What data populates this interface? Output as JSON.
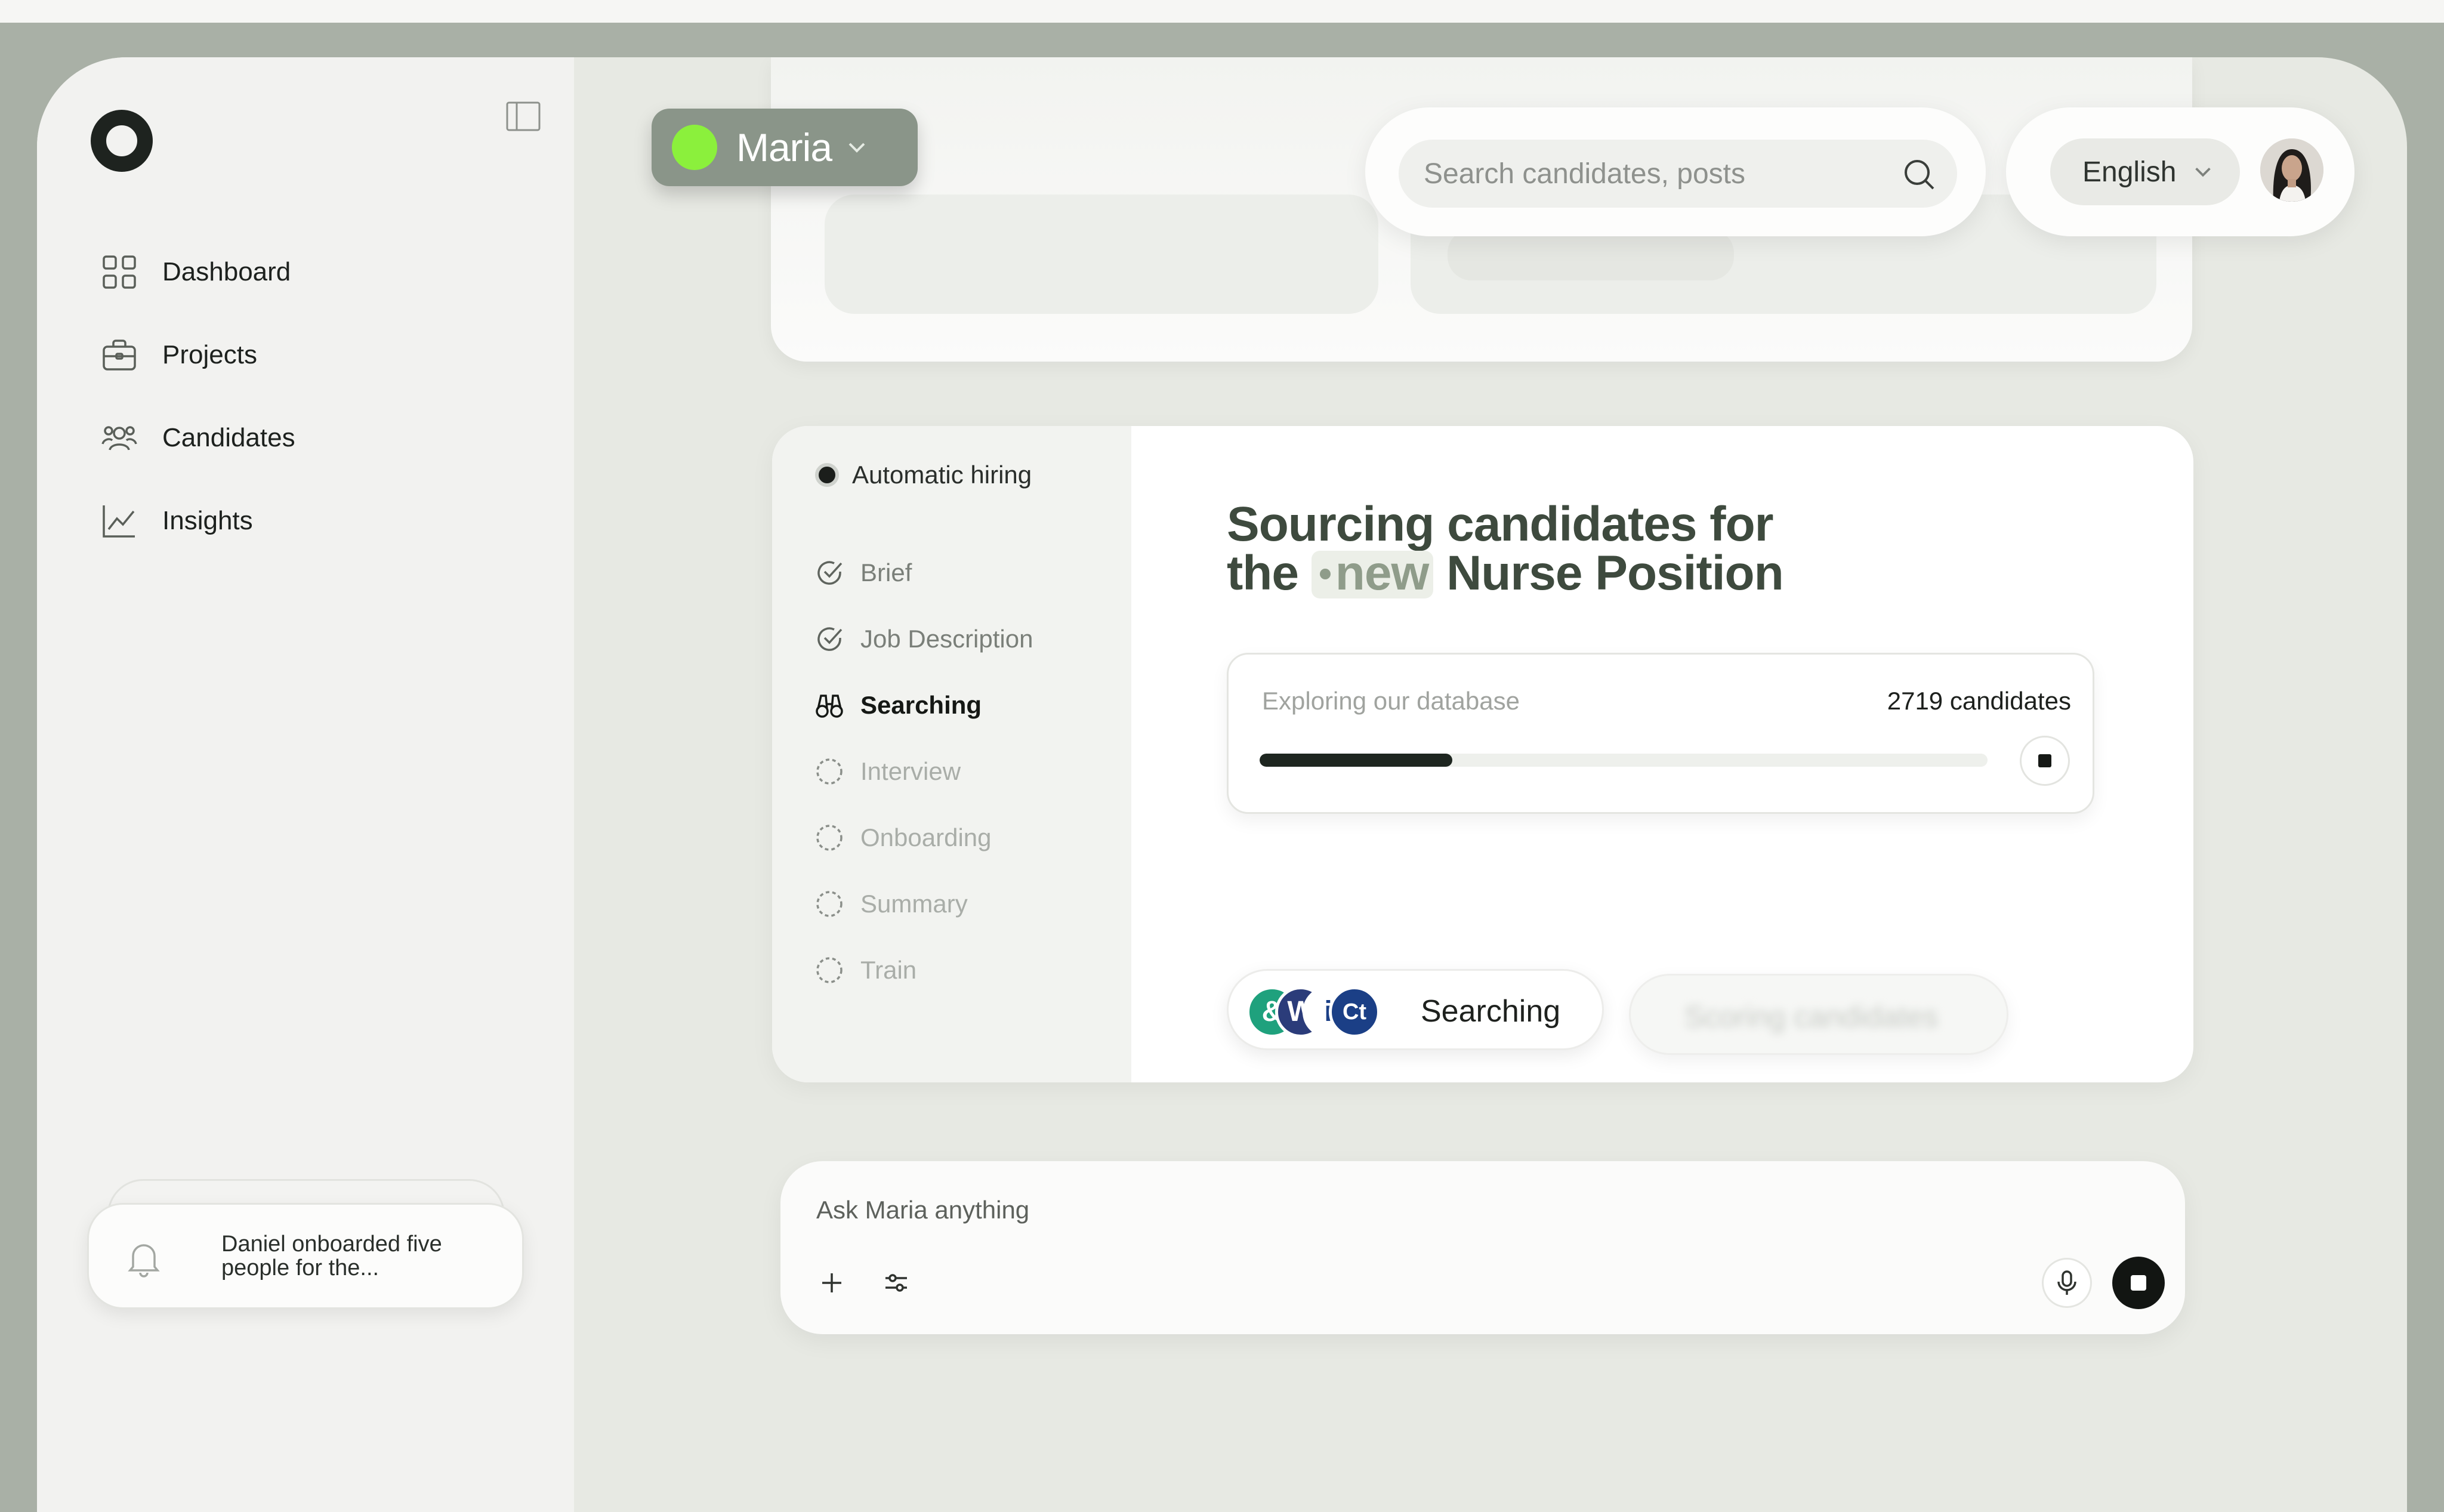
{
  "sidebar": {
    "items": [
      {
        "label": "Dashboard",
        "icon": "grid-icon"
      },
      {
        "label": "Projects",
        "icon": "briefcase-icon"
      },
      {
        "label": "Candidates",
        "icon": "users-icon"
      },
      {
        "label": "Insights",
        "icon": "chart-icon"
      }
    ],
    "notification": "Daniel onboarded five people for the..."
  },
  "header": {
    "agent_name": "Maria",
    "agent_color": "#8bf03c",
    "search_placeholder": "Search candidates, posts",
    "language": "English"
  },
  "workflow": {
    "title": "Automatic hiring",
    "steps": [
      {
        "label": "Brief",
        "state": "done"
      },
      {
        "label": "Job Description",
        "state": "done"
      },
      {
        "label": "Searching",
        "state": "active"
      },
      {
        "label": "Interview",
        "state": "todo"
      },
      {
        "label": "Onboarding",
        "state": "todo"
      },
      {
        "label": "Summary",
        "state": "todo"
      },
      {
        "label": "Train",
        "state": "todo"
      }
    ],
    "headline_part1": "Sourcing candidates for",
    "headline_the": "the",
    "headline_tag": "new",
    "headline_part2": "Nurse Position",
    "progress_label": "Exploring our database",
    "progress_count": "2719 candidates",
    "progress_fraction": 0.265,
    "status_label": "Searching",
    "next_status_label": "Scoring candidates"
  },
  "chat": {
    "placeholder": "Ask Maria anything"
  }
}
